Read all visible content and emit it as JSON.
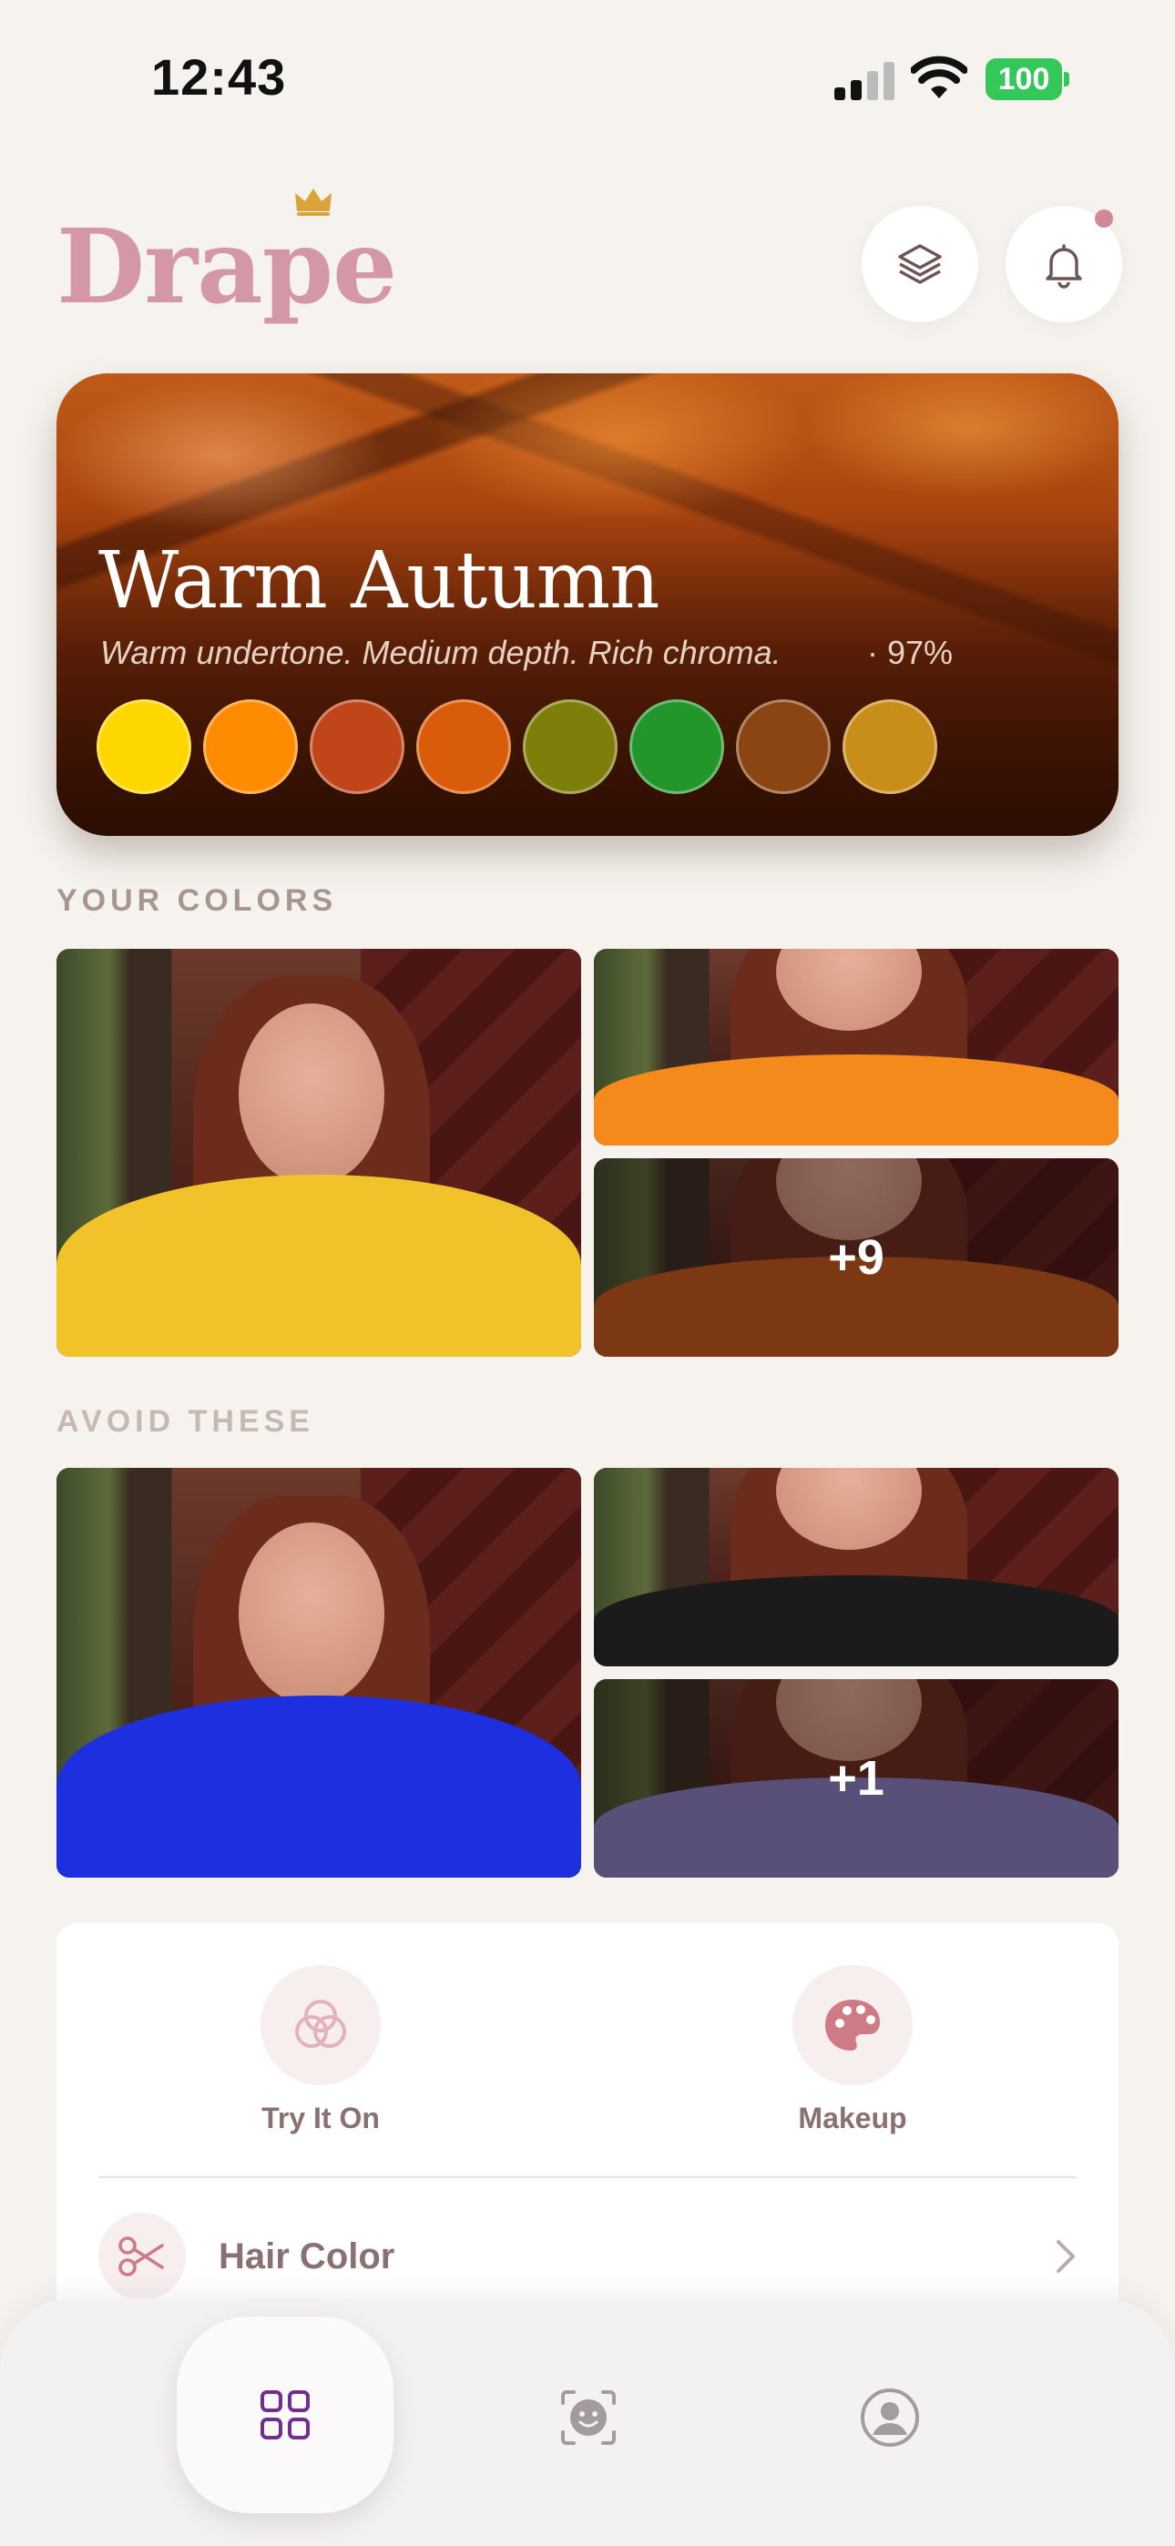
{
  "status": {
    "time": "12:43",
    "battery": "100"
  },
  "app": {
    "logo": "Drape"
  },
  "header": {
    "layers_icon": "layers-icon",
    "bell_icon": "bell-icon"
  },
  "season": {
    "title": "Warm Autumn",
    "description": "Warm undertone. Medium depth. Rich chroma.",
    "match": "· 97%",
    "swatches": [
      "#FFD700",
      "#FF8C00",
      "#C0461A",
      "#D95C0A",
      "#7E7F0B",
      "#22962A",
      "#8B4513",
      "#C98E19"
    ]
  },
  "your_colors": {
    "label": "YOUR COLORS",
    "photos": [
      {
        "shirt": "#F2C22A"
      },
      {
        "shirt": "#F58A1C"
      },
      {
        "shirt": "#C85A1A",
        "more": "+9"
      }
    ]
  },
  "avoid": {
    "label": "AVOID THESE",
    "photos": [
      {
        "shirt": "#1E2FE0"
      },
      {
        "shirt": "#1B1B1B"
      },
      {
        "shirt": "#8A84C8",
        "more": "+1"
      }
    ]
  },
  "actions": {
    "try_on": "Try It On",
    "makeup": "Makeup",
    "hair_color": "Hair Color"
  },
  "tabs": [
    "grid-icon",
    "face-scan-icon",
    "profile-icon"
  ]
}
